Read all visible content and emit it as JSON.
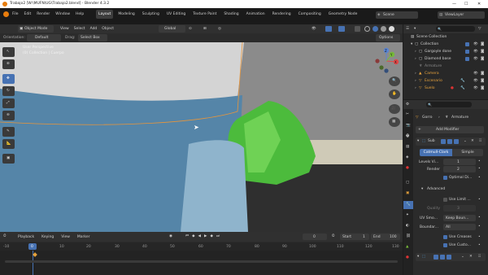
{
  "window": {
    "title": "Trabajo2 [W:\\MUFN\\UG\\Trabajo2.blend] - Blender 4.3.2",
    "minimize": "—",
    "maximize": "☐",
    "close": "✕"
  },
  "topbar": {
    "menus": [
      "File",
      "Edit",
      "Render",
      "Window",
      "Help"
    ],
    "workspaces": [
      "Layout",
      "Modeling",
      "Sculpting",
      "UV Editing",
      "Texture Paint",
      "Shading",
      "Animation",
      "Rendering",
      "Compositing",
      "Geometry Node"
    ],
    "active_workspace": "Layout",
    "scene": "Scene",
    "view_layer": "ViewLayer"
  },
  "viewport_header": {
    "mode": "Object Mode",
    "menus": [
      "View",
      "Select",
      "Add",
      "Object"
    ],
    "transform": "Global",
    "options": "Options"
  },
  "toolheader": {
    "orientation_label": "Orientation:",
    "orientation_value": "Default",
    "drag_label": "Drag:",
    "drag_value": "Select Box"
  },
  "viewport": {
    "overlay_line1": "User Perspective",
    "overlay_line2": "(0) Collection | Cuerpo",
    "gizmo": {
      "z": "Z",
      "y": "Y",
      "x": "X"
    }
  },
  "outliner": {
    "search_placeholder": "",
    "title": "Scene Collection",
    "items": [
      {
        "label": "Collection",
        "color": "#cccccc"
      },
      {
        "label": "Gargoyle done",
        "color": "#cccccc"
      },
      {
        "label": "Diamond base",
        "color": "#cccccc"
      },
      {
        "label": "Armature",
        "color": "#8a8a8a"
      },
      {
        "label": "Camera",
        "color": "#e6a23c"
      },
      {
        "label": "Escenario",
        "color": "#e6a23c"
      },
      {
        "label": "Suelo",
        "color": "#e6a23c"
      }
    ]
  },
  "properties": {
    "breadcrumb_object": "Gorro",
    "breadcrumb_arrow": "›",
    "breadcrumb_mod": "Armature",
    "add_modifier": "Add Modifier",
    "modifier_name": "Sub",
    "subsurf_modes": [
      "Catmull-Clark",
      "Simple"
    ],
    "levels_viewport_label": "Levels Vi...",
    "levels_viewport_value": "1",
    "render_label": "Render",
    "render_value": "2",
    "optimal_display": "Optimal Di...",
    "advanced": "Advanced",
    "use_limit": "Use Limit ...",
    "quality_label": "Quality",
    "quality_value": "3",
    "uv_smooth_label": "UV Smo...",
    "uv_smooth_value": "Keep Boun...",
    "boundary_label": "Boundar...",
    "boundary_value": "All",
    "use_creases": "Use Creases",
    "use_custom": "Use Custo..."
  },
  "timeline": {
    "menus": [
      "Playback",
      "Keying",
      "View",
      "Marker"
    ],
    "current_frame": "0",
    "start_label": "Start",
    "start_value": "1",
    "end_label": "End",
    "end_value": "100",
    "ticks": [
      "-10",
      "0",
      "10",
      "20",
      "30",
      "40",
      "50",
      "60",
      "70",
      "80",
      "90",
      "100",
      "110",
      "120",
      "130"
    ],
    "playhead": "0"
  }
}
